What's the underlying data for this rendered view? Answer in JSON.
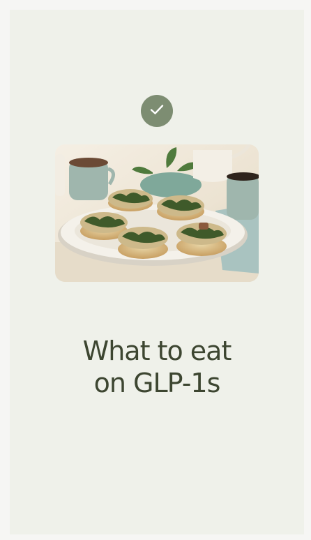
{
  "icons": {
    "status": "check-icon"
  },
  "image": {
    "subject": "spinach-egg-muffins-food-photo",
    "alt": ""
  },
  "title": {
    "line1": "What to eat",
    "line2": "on GLP-1s"
  },
  "colors": {
    "background": "#eff1ea",
    "badge": "#7d8d72",
    "title": "#3d4631"
  }
}
